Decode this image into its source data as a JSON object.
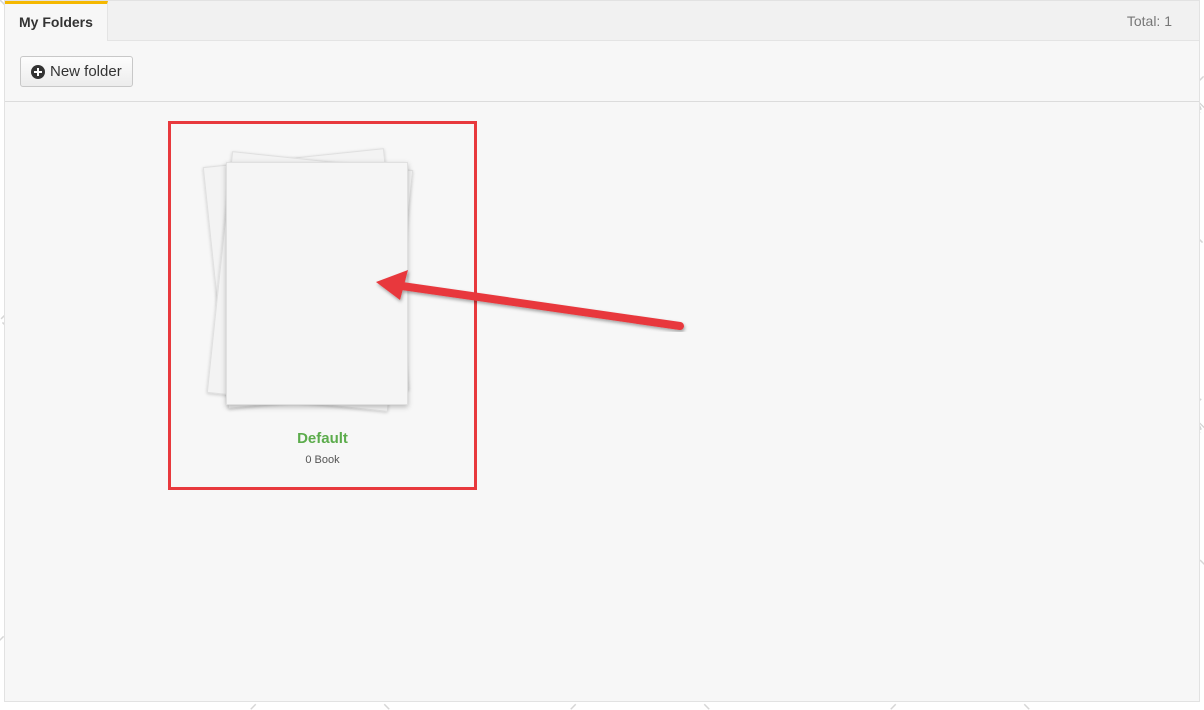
{
  "tabs": [
    {
      "label": "My Folders",
      "active": true
    }
  ],
  "summary": {
    "total_text": "Total: 1"
  },
  "toolbar": {
    "new_folder_label": "New folder",
    "new_folder_icon": "plus-circle-icon"
  },
  "folders": [
    {
      "name": "Default",
      "count_text": "0 Book"
    }
  ],
  "watermark": {
    "brand": "SEOBUDDY",
    "url": "WWW.SEOBUDDY.COM"
  },
  "annotation": {
    "highlight_color": "#e8393d",
    "arrow_color": "#e8393d"
  },
  "colors": {
    "tab_accent": "#f5b800",
    "folder_name": "#5cac4c"
  }
}
